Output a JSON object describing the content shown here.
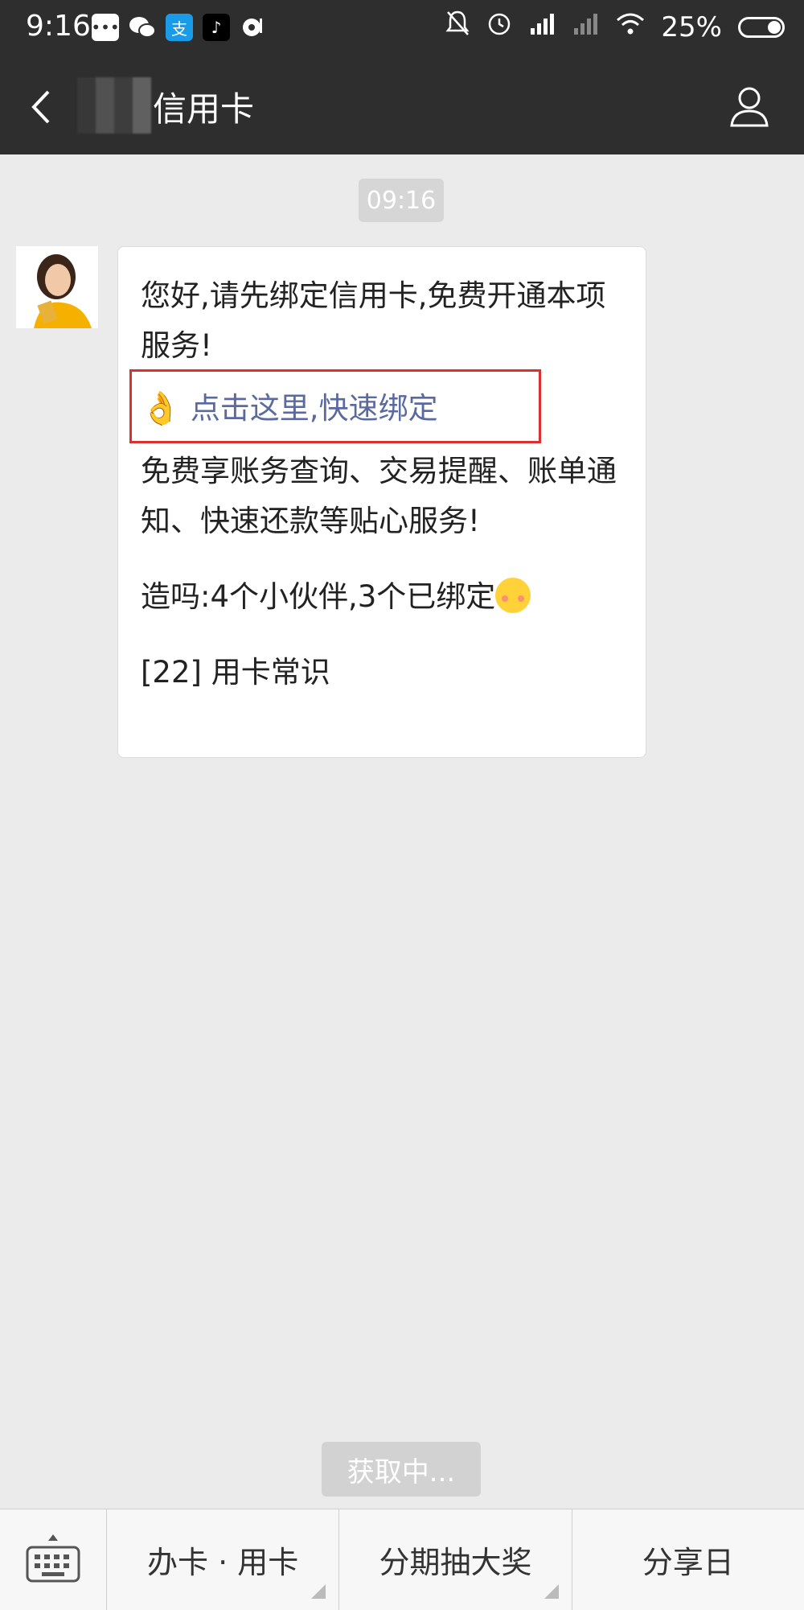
{
  "status_bar": {
    "time": "9:16",
    "battery_percent": "25%",
    "icons_left": [
      "message-icon",
      "wechat-icon",
      "alipay-icon",
      "tiktok-icon",
      "music-icon"
    ],
    "icons_right": [
      "mute-icon",
      "alarm-icon",
      "signal-icon",
      "signal-2-icon",
      "wifi-icon",
      "battery-icon"
    ]
  },
  "nav": {
    "title": "信用卡"
  },
  "chat": {
    "timestamp": "09:16",
    "message": {
      "line1": "您好,请先绑定信用卡,免费开通本项服务!",
      "link_text": "点击这里,快速绑定",
      "line2": "免费享账务查询、交易提醒、账单通知、快速还款等贴心服务!",
      "line3": "造吗:4个小伙伴,3个已绑定",
      "line4": "[22] 用卡常识"
    }
  },
  "loading": {
    "text": "获取中..."
  },
  "bottom_menu": {
    "items": [
      {
        "label": "办卡 · 用卡"
      },
      {
        "label": "分期抽大奖"
      },
      {
        "label": "分享日"
      }
    ]
  },
  "colors": {
    "bar_bg": "#2e2e2e",
    "chat_bg": "#ebebeb",
    "link": "#5a6aa0",
    "highlight": "#d93030"
  }
}
